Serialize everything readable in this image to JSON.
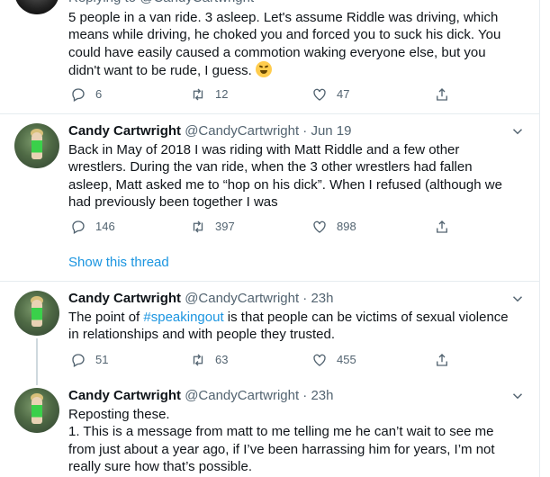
{
  "tweet0": {
    "replying": "Replying to @CandyCartwright",
    "lines": [
      "5 people in a van ride. 3 asleep. Let's assume Riddle was driving, which",
      "means while driving, he choked you and forced you to suck his dick. You",
      "could have easily caused a commotion waking everyone else, but you",
      "didn't want to be rude, I guess."
    ],
    "emoji": "rolling-on-floor-laughing-emoji",
    "replies": "6",
    "retweets": "12",
    "likes": "47"
  },
  "tweet1": {
    "name": "Candy Cartwright",
    "handle": "@CandyCartwright",
    "time": "· Jun 19",
    "lines": [
      "Back in May of 2018 I was riding with Matt Riddle and a few other",
      "wrestlers. During the van ride, when the 3 other wrestlers had fallen",
      "asleep, Matt asked me to “hop on his dick”. When I refused (although we",
      "had previously been together I was"
    ],
    "replies": "146",
    "retweets": "397",
    "likes": "898",
    "show_thread": "Show this thread"
  },
  "tweet2": {
    "name": "Candy Cartwright",
    "handle": "@CandyCartwright",
    "time": "· 23h",
    "line1_pre": "The point of ",
    "line1_link": "#speakingout",
    "line1_post": " is that people can be victims of sexual violence",
    "line2": "in relationships and with people they trusted.",
    "replies": "51",
    "retweets": "63",
    "likes": "455"
  },
  "tweet3": {
    "name": "Candy Cartwright",
    "handle": "@CandyCartwright",
    "time": "· 23h",
    "lines": [
      "Reposting these.",
      "1. This is a message from matt to me telling me he can’t wait to see me",
      "from just about a year ago, if I’ve been harrassing him for years, I’m not",
      "really sure how that’s possible."
    ]
  },
  "colors": {
    "link": "#1b95e0",
    "secondary": "#536471",
    "divider": "#e6ecf0"
  }
}
